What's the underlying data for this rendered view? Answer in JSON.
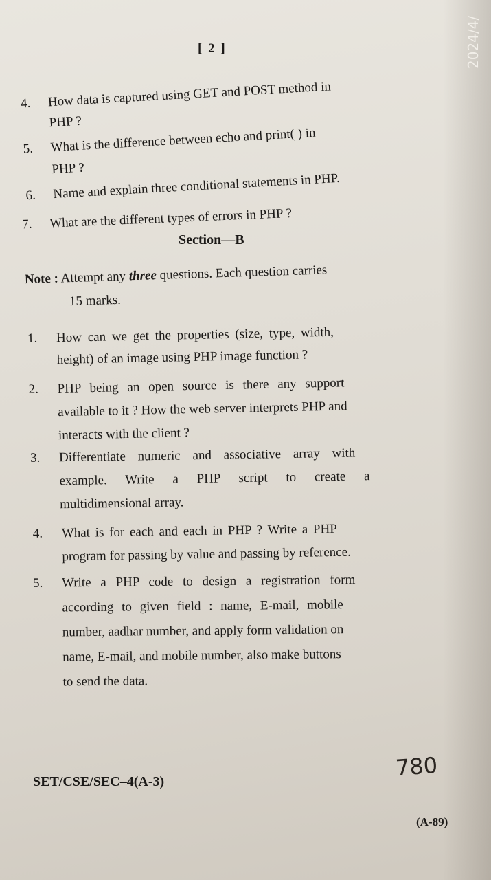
{
  "stamp_date": "2024/4/",
  "page_number": "[ 2 ]",
  "section_a_tail": [
    {
      "num": "4.",
      "lines": [
        "How data is captured using GET and POST method in",
        "PHP ?"
      ]
    },
    {
      "num": "5.",
      "lines": [
        "What is the difference between echo and print( ) in",
        "PHP ?"
      ]
    },
    {
      "num": "6.",
      "lines": [
        "Name and explain three conditional statements in PHP."
      ]
    },
    {
      "num": "7.",
      "lines": [
        "What are the different types of errors in PHP ?"
      ]
    }
  ],
  "section_title": "Section—B",
  "note": {
    "label": "Note :",
    "line1_a": "Attempt any ",
    "line1_b": "three",
    "line1_c": " questions. Each question carries",
    "line2": "15 marks."
  },
  "section_b": [
    {
      "num": "1.",
      "lines": [
        "How can we get the properties (size, type, width,",
        "height) of an image using PHP image function ?"
      ]
    },
    {
      "num": "2.",
      "lines": [
        "PHP being an open source is there any support",
        "available to it ? How the web server interprets PHP and",
        "interacts with the client ?"
      ]
    },
    {
      "num": "3.",
      "lines": [
        "Differentiate numeric and associative array with",
        "example. Write a PHP script to create a",
        "multidimensional array."
      ]
    },
    {
      "num": "4.",
      "lines": [
        "What is for each and each in PHP ? Write a PHP",
        "program for passing by value and passing by reference."
      ]
    },
    {
      "num": "5.",
      "lines": [
        "Write a PHP code to design a registration form",
        "according to given field : name, E-mail, mobile",
        "number, aadhar number, and apply form validation on",
        "name, E-mail, and mobile number, also make buttons",
        "to send the data."
      ]
    }
  ],
  "footer": {
    "code": "SET/CSE/SEC–4(A-3)",
    "handwritten": "780",
    "page_id": "(A-89)"
  }
}
